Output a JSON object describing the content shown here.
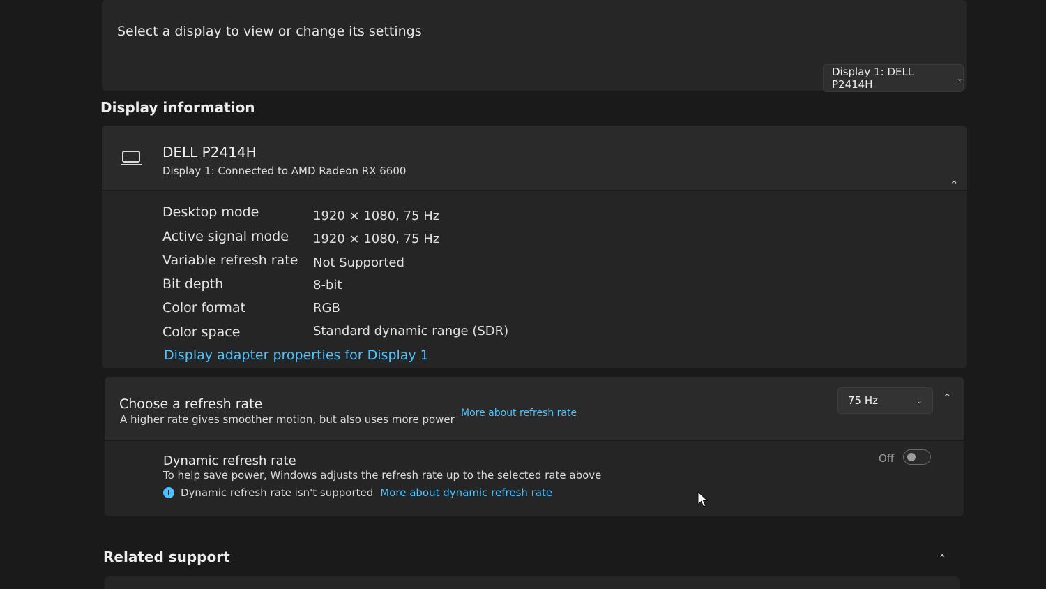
{
  "select_display": {
    "label": "Select a display to view or change its settings",
    "dropdown_value": "Display 1: DELL P2414H"
  },
  "display_information": {
    "section_title": "Display information",
    "monitor_name": "DELL P2414H",
    "monitor_subtitle": "Display 1: Connected to AMD Radeon RX 6600",
    "properties": [
      {
        "label": "Desktop mode",
        "value": "1920 × 1080, 75 Hz"
      },
      {
        "label": "Active signal mode",
        "value": "1920 × 1080, 75 Hz"
      },
      {
        "label": "Variable refresh rate",
        "value": "Not Supported"
      },
      {
        "label": "Bit depth",
        "value": "8-bit"
      },
      {
        "label": "Color format",
        "value": "RGB"
      },
      {
        "label": "Color space",
        "value": "Standard dynamic range (SDR)"
      }
    ],
    "adapter_link": "Display adapter properties for Display 1"
  },
  "refresh_rate": {
    "title": "Choose a refresh rate",
    "description": "A higher rate gives smoother motion, but also uses more power",
    "link": "More about refresh rate",
    "selected": "75 Hz"
  },
  "dynamic_refresh": {
    "title": "Dynamic refresh rate",
    "description": "To help save power, Windows adjusts the refresh rate up to the selected rate above",
    "note": "Dynamic refresh rate isn't supported",
    "link": "More about dynamic refresh rate",
    "toggle_label": "Off",
    "info_glyph": "i"
  },
  "related_support": {
    "section_title": "Related support"
  },
  "icons": {
    "chevron_down": "⌄",
    "chevron_up": "⌃"
  }
}
